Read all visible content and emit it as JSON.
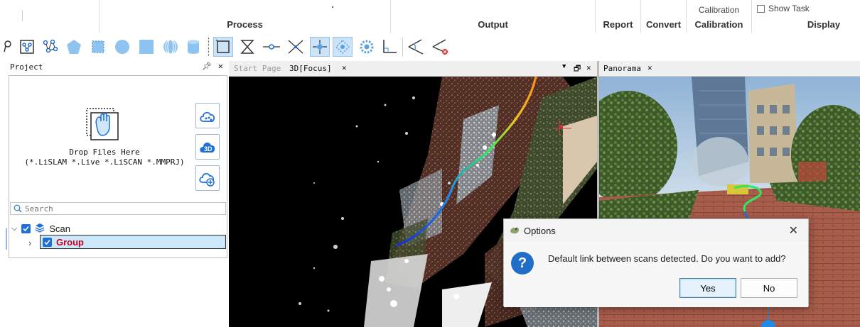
{
  "ribbon": {
    "groups": [
      {
        "label": "Process"
      },
      {
        "label": "Output"
      },
      {
        "label": "Report"
      },
      {
        "label": "Convert"
      },
      {
        "label": "Calibration",
        "top_label": "Calibration"
      },
      {
        "label": "Display"
      }
    ],
    "show_task": "Show Task"
  },
  "toolbar": {
    "icons": [
      "lasso-icon",
      "network-select-icon",
      "node-graph-icon",
      "pentagon-icon",
      "rectangle-select-icon",
      "circle-icon",
      "square-icon",
      "sphere-icon",
      "cylinder-icon",
      "box-frame-icon",
      "hourglass-icon",
      "point-line-icon",
      "cross-icon",
      "diamond-point-icon",
      "dotted-diamond-icon",
      "gear-cluster-icon",
      "angle-icon",
      "ruler-angle-icon",
      "ruler-delete-icon"
    ]
  },
  "project": {
    "title": "Project",
    "drop_line1": "Drop Files Here",
    "drop_line2": "(*.LiSLAM *.Live *.LiSCAN *.MMPRJ)",
    "search_placeholder": "Search",
    "tree": [
      {
        "label": "Scan"
      },
      {
        "label": "Group"
      }
    ]
  },
  "views": {
    "tabs_3d": [
      {
        "label": "Start Page"
      },
      {
        "label": "3D[Focus]"
      }
    ],
    "tabs_pano": [
      {
        "label": "Panorama"
      }
    ]
  },
  "dialog": {
    "title": "Options",
    "message": "Default link between scans detected. Do you want to add?",
    "yes": "Yes",
    "no": "No"
  },
  "colors": {
    "accent": "#1f6fc9",
    "group_label": "#d0021b",
    "selection": "#cde8fb"
  }
}
